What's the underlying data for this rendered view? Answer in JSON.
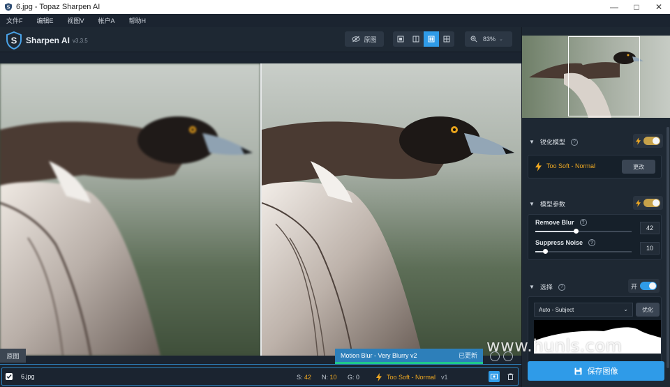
{
  "window": {
    "title": "6.jpg - Topaz Sharpen AI",
    "minimize_icon": "minimize-icon",
    "maximize_icon": "maximize-icon",
    "close_icon": "close-icon"
  },
  "menu": [
    "文件F",
    "编辑E",
    "视图V",
    "帐户A",
    "帮助H"
  ],
  "app": {
    "name": "Sharpen AI",
    "version": "v3.3.5"
  },
  "toolbar": {
    "original_label": "原图",
    "zoom": "83%"
  },
  "canvas": {
    "original_tag": "原图"
  },
  "notification": {
    "model": "Motion Blur - Very Blurry v2",
    "status": "已更新"
  },
  "filmstrip": {
    "file": "6.jpg",
    "s_label": "S:",
    "s_value": "42",
    "n_label": "N:",
    "n_value": "10",
    "g_label": "G:",
    "g_value": "0",
    "model": "Too Soft - Normal",
    "version": "v1"
  },
  "panel": {
    "sharpen_model": {
      "title": "锐化模型",
      "model": "Too Soft - Normal",
      "change_label": "更改",
      "enabled": true
    },
    "model_params": {
      "title": "模型参数",
      "enabled": true,
      "remove_blur": {
        "label": "Remove Blur",
        "value": "42",
        "fraction": 0.42
      },
      "suppress_noise": {
        "label": "Suppress Noise",
        "value": "10",
        "fraction": 0.1
      }
    },
    "selection": {
      "title": "选择",
      "toggle_label": "开",
      "mode": "Auto - Subject",
      "optimize_label": "优化",
      "enabled": true
    },
    "save_label": "保存图像"
  },
  "watermark": "www.hunls.com",
  "colors": {
    "accent": "#2f9be8",
    "warning": "#f0a922",
    "toggle_on": "#c7a24a",
    "success": "#1fc98b"
  }
}
